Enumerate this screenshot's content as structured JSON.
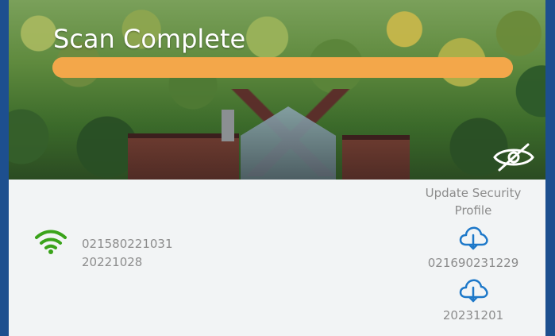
{
  "scan": {
    "title": "Scan Complete",
    "progress": 1.0
  },
  "visibility": {
    "icon": "eye-slash-icon"
  },
  "device": {
    "wifi_icon": "wifi-icon",
    "id": "021580221031",
    "date": "20221028"
  },
  "security_profile": {
    "label_line1": "Update Security",
    "label_line2": "Profile",
    "download_icon": "cloud-download-icon",
    "value1": "021690231229",
    "value2": "20231201"
  },
  "colors": {
    "frame": "#1d4f8f",
    "progress": "#f3a74a",
    "wifi": "#3aa31a",
    "cloud": "#1d78c9",
    "text_muted": "#8c8c8c"
  }
}
